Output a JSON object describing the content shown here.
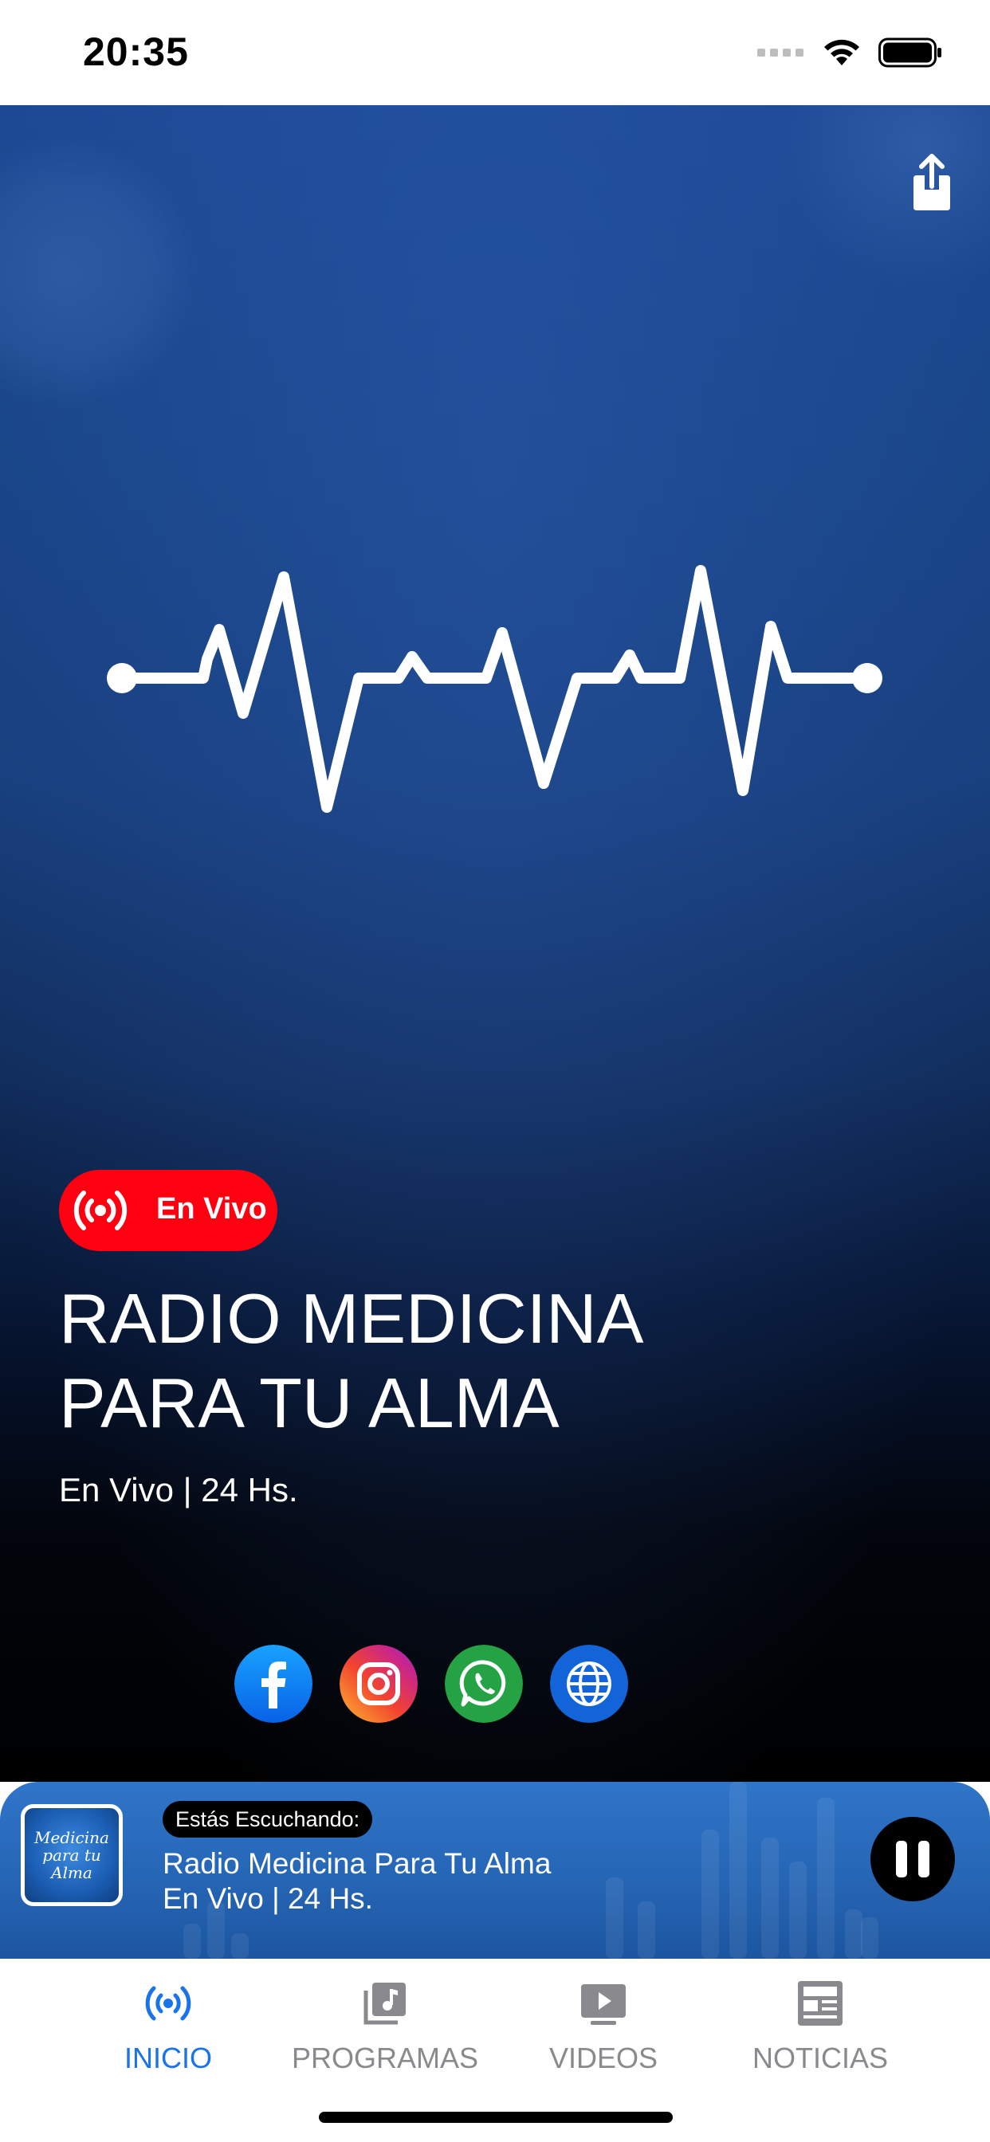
{
  "status_bar": {
    "time": "20:35",
    "icons": [
      "signal-dots-icon",
      "wifi-icon",
      "battery-icon"
    ]
  },
  "hero": {
    "share_icon": "share-icon",
    "live_badge": {
      "icon": "broadcast-icon",
      "label": "En Vivo",
      "color": "#ff0010"
    },
    "title_line1": "RADIO MEDICINA",
    "title_line2": "PARA TU ALMA",
    "subtitle": "En Vivo | 24 Hs.",
    "social": [
      {
        "name": "facebook",
        "icon": "facebook-icon",
        "color": "#1877f2"
      },
      {
        "name": "instagram",
        "icon": "instagram-icon",
        "color": "#e4405f"
      },
      {
        "name": "whatsapp",
        "icon": "whatsapp-icon",
        "color": "#25a244"
      },
      {
        "name": "website",
        "icon": "globe-icon",
        "color": "#1264d8"
      }
    ]
  },
  "player": {
    "now_playing_label": "Estás Escuchando:",
    "track_title": "Radio Medicina Para Tu Alma",
    "track_subtitle": "En Vivo | 24 Hs.",
    "album_art_text_line1": "Medicina",
    "album_art_text_line2": "para tu Alma",
    "state": "playing"
  },
  "tabs": [
    {
      "label": "INICIO",
      "icon": "broadcast-icon",
      "active": true
    },
    {
      "label": "PROGRAMAS",
      "icon": "music-library-icon",
      "active": false
    },
    {
      "label": "VIDEOS",
      "icon": "video-play-icon",
      "active": false
    },
    {
      "label": "NOTICIAS",
      "icon": "newspaper-icon",
      "active": false
    }
  ],
  "colors": {
    "accent": "#1a73e8",
    "tab_inactive": "#8a8a8e",
    "hero_top": "#1b4892",
    "player_bg": "#2f75c9"
  }
}
